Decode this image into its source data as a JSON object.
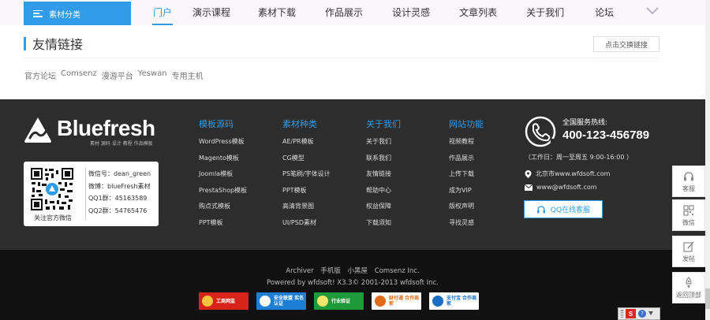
{
  "nav": {
    "category_label": "素材分类",
    "items": [
      {
        "label": "门户",
        "active": true
      },
      {
        "label": "演示课程"
      },
      {
        "label": "素材下载"
      },
      {
        "label": "作品展示"
      },
      {
        "label": "设计灵感"
      },
      {
        "label": "文章列表"
      },
      {
        "label": "关于我们"
      },
      {
        "label": "论坛"
      }
    ]
  },
  "friend_links": {
    "title": "友情链接",
    "exchange_button": "点击交换链接",
    "links": [
      "官方论坛",
      "Comsenz",
      "漫游平台",
      "Yeswan",
      "专用主机"
    ]
  },
  "footer": {
    "logo": {
      "name": "Bluefresh",
      "tagline": "素材 源码 设计 教程 作品模板"
    },
    "qr": {
      "caption": "关注官方微信",
      "lines": [
        "微信号：dean_green",
        "微博：blueFresh素材",
        "QQ1群：45163589",
        "QQ2群：54765476"
      ]
    },
    "columns": [
      {
        "heading": "模板源码",
        "items": [
          "WordPress模板",
          "Magento模板",
          "Joomla模板",
          "PrestaShop模板",
          "购点式模板",
          "PPT模板"
        ]
      },
      {
        "heading": "素材种类",
        "items": [
          "AE/PR模板",
          "CG模型",
          "PS笔刷/字体设计",
          "PPT模板",
          "高清背景图",
          "UI/PSD素材"
        ]
      },
      {
        "heading": "关于我们",
        "items": [
          "关于我们",
          "联系我们",
          "友情链接",
          "帮助中心",
          "权益保障",
          "下载须知"
        ]
      },
      {
        "heading": "网站功能",
        "items": [
          "视频教程",
          "作品展示",
          "上传下载",
          "成为VIP",
          "版权声明",
          "寻找灵感"
        ]
      }
    ],
    "service": {
      "label": "全国服务热线:",
      "phone": "400-123-456789",
      "hours": "（工作日：周一至周五 9:00-16:00 ）",
      "address": "北京市www.wfdsoft.com",
      "email": "www@wfdsoft.com",
      "qq_button": "QQ在线客服"
    }
  },
  "bottom": {
    "links": [
      "Archiver",
      "手机版",
      "小黑屋",
      "Comsenz Inc."
    ],
    "powered": "Powered by wfdsoft! X3.3© 2001-2013 wfdsoft Inc.",
    "badges": [
      {
        "text": "工商网监",
        "bg": "#d8231b",
        "fg": "#ffffff",
        "icon": "#f3c43d"
      },
      {
        "text": "安全联盟 实名认证",
        "bg": "#1d7ed6",
        "fg": "#ffffff",
        "icon": "#ffffff"
      },
      {
        "text": "行业验证",
        "bg": "#1f9a3a",
        "fg": "#ffffff",
        "icon": "#f5e36b"
      },
      {
        "text": "财付通 合作商家",
        "bg": "#ffffff",
        "fg": "#e06a1a",
        "icon": "#e06a1a"
      },
      {
        "text": "支付宝 合作商家",
        "bg": "#ffffff",
        "fg": "#1a6fc4",
        "icon": "#1a6fc4"
      }
    ]
  },
  "float_bar": [
    {
      "label": "客服",
      "icon": "headset-icon"
    },
    {
      "label": "微信",
      "icon": "qrcode-icon"
    },
    {
      "label": "发帖",
      "icon": "pencil-icon"
    },
    {
      "label": "返回顶部",
      "icon": "rocket-icon"
    }
  ],
  "colors": {
    "accent": "#2f9be9",
    "footer_bg": "#2d2d2d",
    "bottom_bg": "#111111"
  }
}
